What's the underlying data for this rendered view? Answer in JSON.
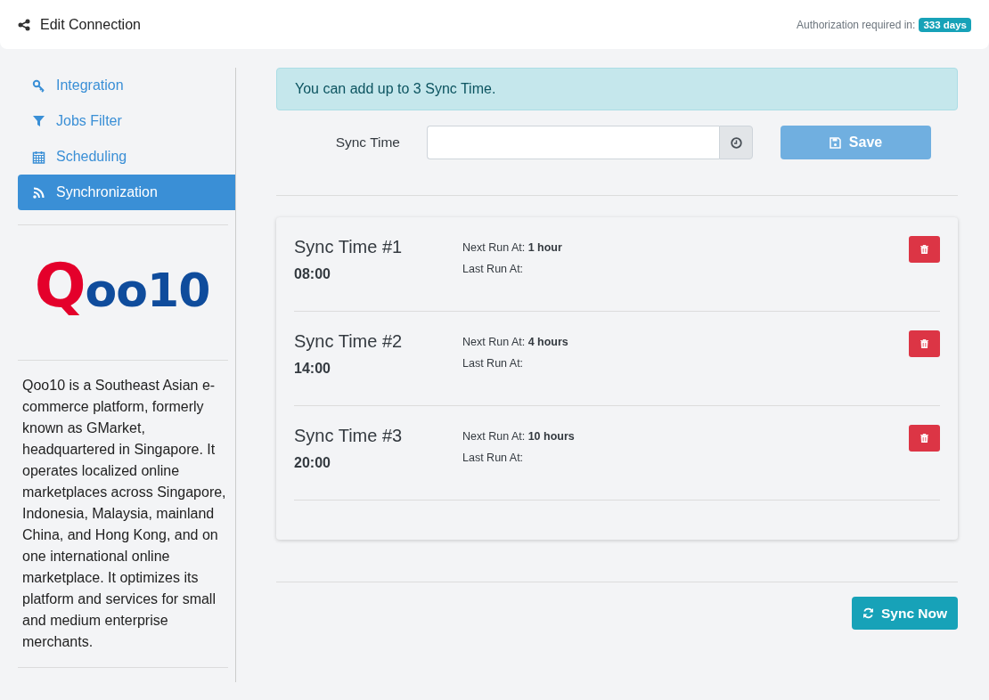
{
  "header": {
    "title": "Edit Connection",
    "auth_label": "Authorization required in:",
    "auth_badge": "333 days"
  },
  "sidebar": {
    "items": [
      {
        "label": "Integration",
        "selected": false
      },
      {
        "label": "Jobs Filter",
        "selected": false
      },
      {
        "label": "Scheduling",
        "selected": false
      },
      {
        "label": "Synchronization",
        "selected": true
      }
    ],
    "logo": "Qoo10",
    "description": "Qoo10 is a Southeast Asian e-commerce platform, formerly known as GMarket, headquartered in Singapore. It operates localized online marketplaces across Singapore, Indonesia, Malaysia, mainland China, and Hong Kong, and on one international online marketplace. It optimizes its platform and services for small and medium enterprise merchants."
  },
  "alert": "You can add up to 3 Sync Time.",
  "form": {
    "label": "Sync Time",
    "save_button": "Save"
  },
  "sync_times": [
    {
      "title": "Sync Time #1",
      "time": "08:00",
      "next_label": "Next Run At:",
      "next_value": "1 hour",
      "last_label": "Last Run At:"
    },
    {
      "title": "Sync Time #2",
      "time": "14:00",
      "next_label": "Next Run At:",
      "next_value": "4 hours",
      "last_label": "Last Run At:"
    },
    {
      "title": "Sync Time #3",
      "time": "20:00",
      "next_label": "Next Run At:",
      "next_value": "10 hours",
      "last_label": "Last Run At:"
    }
  ],
  "sync_now_button": "Sync Now"
}
